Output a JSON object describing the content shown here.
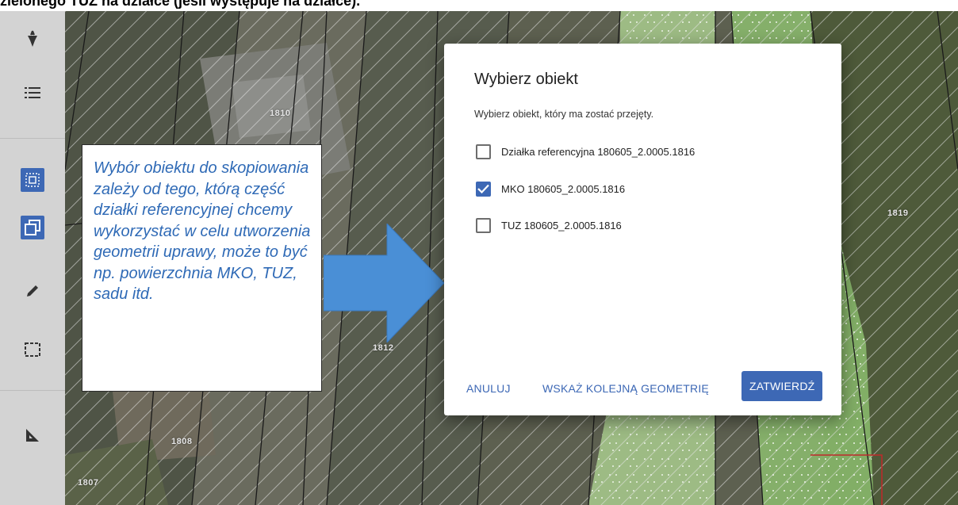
{
  "page": {
    "header_text": "zielonego TUZ na działce (jeśli występuje na działce)."
  },
  "toolbar": {
    "items": [
      {
        "name": "logo",
        "icon": "beet-logo-icon"
      },
      {
        "name": "layers",
        "icon": "list-icon"
      },
      {
        "name": "select-area",
        "icon": "select-area-icon",
        "active": true
      },
      {
        "name": "copy-geometry",
        "icon": "copy-geometry-icon",
        "active": true
      },
      {
        "name": "draw",
        "icon": "pencil-icon"
      },
      {
        "name": "selection-frame",
        "icon": "dashed-rectangle-icon"
      },
      {
        "name": "measure",
        "icon": "ruler-triangle-icon"
      }
    ],
    "accent_color": "#3d68b5"
  },
  "map": {
    "parcel_labels": [
      "1810",
      "1812",
      "1808",
      "1807",
      "1819"
    ]
  },
  "callout": {
    "text": "Wybór obiektu do skopiowania zależy od tego, którą część działki referencyjnej chcemy wykorzystać w celu utworzenia geometrii uprawy, może to być np. powierzchnia MKO, TUZ, sadu itd.",
    "text_color": "#2f6ab6",
    "arrow_color": "#4a8fd6"
  },
  "dialog": {
    "title": "Wybierz obiekt",
    "subtitle": "Wybierz obiekt, który ma zostać przejęty.",
    "options": [
      {
        "label": "Działka referencyjna 180605_2.0005.1816",
        "checked": false
      },
      {
        "label": "MKO 180605_2.0005.1816",
        "checked": true
      },
      {
        "label": "TUZ 180605_2.0005.1816",
        "checked": false
      }
    ],
    "buttons": {
      "cancel": "ANULUJ",
      "next_geometry": "WSKAŻ KOLEJNĄ GEOMETRIĘ",
      "confirm": "ZATWIERDŹ"
    }
  }
}
